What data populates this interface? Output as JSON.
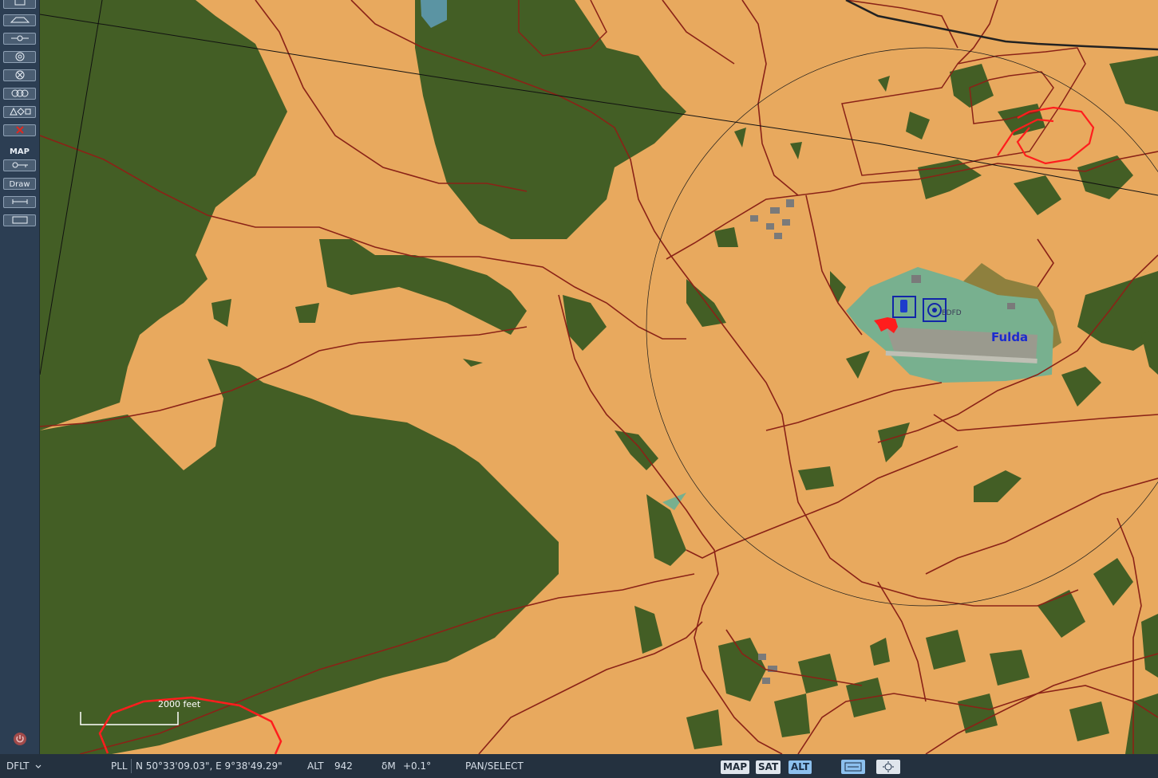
{
  "toolbar": {
    "map_label": "MAP",
    "draw_label": "Draw"
  },
  "map": {
    "place_label": "Fulda",
    "scale_label": "2000 feet",
    "airport_code_label": "EDFD"
  },
  "status": {
    "profile": "DFLT",
    "coord_mode": "PLL",
    "coordinates": "N 50°33'09.03\", E  9°38'49.29\"",
    "alt_label": "ALT",
    "alt_value": "942",
    "mag_var_label": "δM",
    "mag_var_value": "+0.1°",
    "mode": "PAN/SELECT",
    "map_btn": "MAP",
    "sat_btn": "SAT",
    "alt_btn": "ALT"
  },
  "colors": {
    "farmland": "#e8a95e",
    "forest": "#435e25",
    "road": "#8a2217",
    "airport": "#78b08f",
    "annotation": "#ff1d1d",
    "toolbar_bg": "#2c3e53"
  }
}
